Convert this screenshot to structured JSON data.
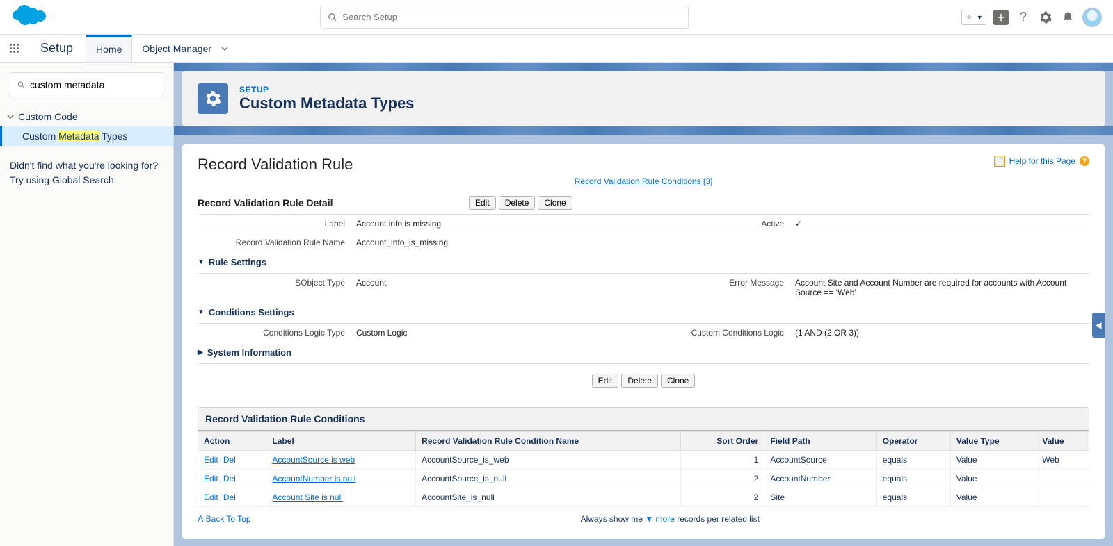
{
  "globalSearch": {
    "placeholder": "Search Setup"
  },
  "contextBar": {
    "appName": "Setup",
    "tabs": {
      "home": "Home",
      "objectManager": "Object Manager"
    }
  },
  "sidebar": {
    "quickFind": {
      "value": "custom metadata"
    },
    "category": "Custom Code",
    "item": {
      "prefix": "Custom ",
      "highlight": "Metadata",
      "suffix": " Types"
    },
    "tipLine1": "Didn't find what you're looking for?",
    "tipLine2": "Try using Global Search."
  },
  "pageHeader": {
    "eyebrow": "SETUP",
    "title": "Custom Metadata Types"
  },
  "content": {
    "pageTitle": "Record Validation Rule",
    "helpLink": "Help for this Page",
    "anchorLink": "Record Validation Rule Conditions [3]",
    "detailHeading": "Record Validation Rule Detail",
    "buttons": {
      "edit": "Edit",
      "delete": "Delete",
      "clone": "Clone"
    },
    "fields": {
      "labelLabel": "Label",
      "labelValue": "Account info is missing",
      "activeLabel": "Active",
      "nameLabel": "Record Validation Rule Name",
      "nameValue": "Account_info_is_missing"
    },
    "ruleSettings": {
      "heading": "Rule Settings",
      "sobjectLabel": "SObject Type",
      "sobjectValue": "Account",
      "errorLabel": "Error Message",
      "errorValue": "Account Site and Account Number are required for accounts with Account Source == 'Web'"
    },
    "conditionsSettings": {
      "heading": "Conditions Settings",
      "logicTypeLabel": "Conditions Logic Type",
      "logicTypeValue": "Custom Logic",
      "customLogicLabel": "Custom Conditions Logic",
      "customLogicValue": "(1 AND (2 OR 3))"
    },
    "sysInfo": {
      "heading": "System Information"
    }
  },
  "related": {
    "heading": "Record Validation Rule Conditions",
    "columns": {
      "action": "Action",
      "label": "Label",
      "name": "Record Validation Rule Condition Name",
      "sortOrder": "Sort Order",
      "fieldPath": "Field Path",
      "operator": "Operator",
      "valueType": "Value Type",
      "value": "Value"
    },
    "actions": {
      "edit": "Edit",
      "del": "Del"
    },
    "rows": [
      {
        "label": "AccountSource is web",
        "name": "AccountSource_is_web",
        "sortOrder": "1",
        "fieldPath": "AccountSource",
        "operator": "equals",
        "valueType": "Value",
        "value": "Web"
      },
      {
        "label": "AccountNumber is null",
        "name": "AccountSource_is_null",
        "sortOrder": "2",
        "fieldPath": "AccountNumber",
        "operator": "equals",
        "valueType": "Value",
        "value": ""
      },
      {
        "label": "Account Site is null",
        "name": "AccountSite_is_null",
        "sortOrder": "2",
        "fieldPath": "Site",
        "operator": "equals",
        "valueType": "Value",
        "value": ""
      }
    ]
  },
  "footer": {
    "backToTop": "Back To Top",
    "pager": {
      "prefix": "Always show me ",
      "more": "more",
      "suffix": " records per related list"
    }
  }
}
